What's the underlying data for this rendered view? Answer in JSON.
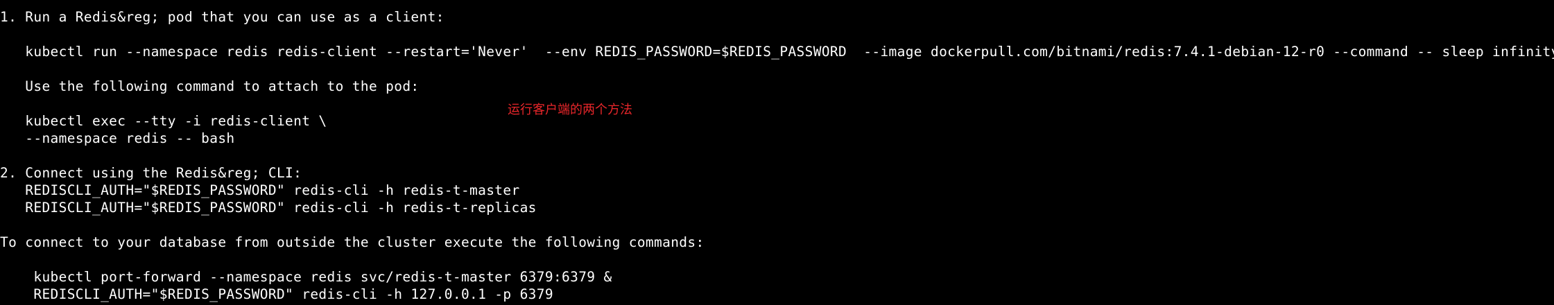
{
  "terminal": {
    "background_color": "#000000",
    "text_color": "#ffffff",
    "lines": [
      "1. Run a Redis&reg; pod that you can use as a client:",
      "   kubectl run --namespace redis redis-client --restart='Never'  --env REDIS_PASSWORD=$REDIS_PASSWORD  --image dockerpull.com/bitnami/redis:7.4.1-debian-12-r0 --command -- sleep infinity",
      "   Use the following command to attach to the pod:",
      "   kubectl exec --tty -i redis-client \\",
      "   --namespace redis -- bash",
      "2. Connect using the Redis&reg; CLI:",
      "   REDISCLI_AUTH=\"$REDIS_PASSWORD\" redis-cli -h redis-t-master",
      "   REDISCLI_AUTH=\"$REDIS_PASSWORD\" redis-cli -h redis-t-replicas",
      "To connect to your database from outside the cluster execute the following commands:",
      "    kubectl port-forward --namespace redis svc/redis-t-master 6379:6379 &",
      "    REDISCLI_AUTH=\"$REDIS_PASSWORD\" redis-cli -h 127.0.0.1 -p 6379"
    ]
  },
  "annotation": {
    "text": "运行客户端的两个方法",
    "color": "#e8262a"
  }
}
